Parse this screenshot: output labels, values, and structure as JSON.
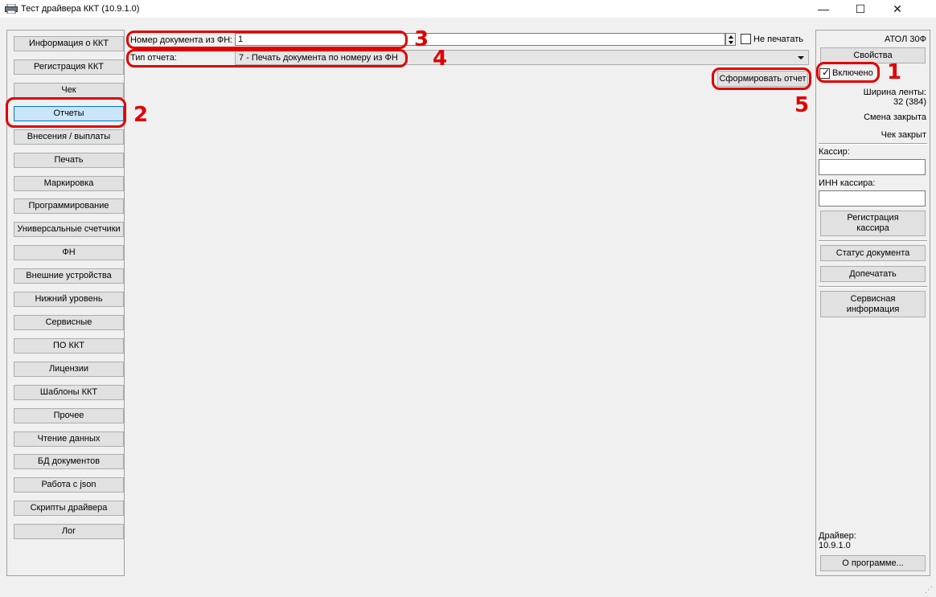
{
  "window": {
    "title": "Тест драйвера ККТ (10.9.1.0)",
    "controls": {
      "minimize": "—",
      "maximize": "☐",
      "close": "✕"
    }
  },
  "nav": {
    "items": [
      {
        "label": "Информация о ККТ",
        "active": false
      },
      {
        "label": "Регистрация ККТ",
        "active": false
      },
      {
        "label": "Чек",
        "active": false
      },
      {
        "label": "Отчеты",
        "active": true
      },
      {
        "label": "Внесения / выплаты",
        "active": false
      },
      {
        "label": "Печать",
        "active": false
      },
      {
        "label": "Маркировка",
        "active": false
      },
      {
        "label": "Программирование",
        "active": false
      },
      {
        "label": "Универсальные счетчики",
        "active": false
      },
      {
        "label": "ФН",
        "active": false
      },
      {
        "label": "Внешние устройства",
        "active": false
      },
      {
        "label": "Нижний уровень",
        "active": false
      },
      {
        "label": "Сервисные",
        "active": false
      },
      {
        "label": "ПО ККТ",
        "active": false
      },
      {
        "label": "Лицензии",
        "active": false
      },
      {
        "label": "Шаблоны ККТ",
        "active": false
      },
      {
        "label": "Прочее",
        "active": false
      },
      {
        "label": "Чтение данных",
        "active": false
      },
      {
        "label": "БД документов",
        "active": false
      },
      {
        "label": "Работа с json",
        "active": false
      },
      {
        "label": "Скрипты драйвера",
        "active": false
      },
      {
        "label": "Лог",
        "active": false
      }
    ]
  },
  "report": {
    "doc_number_label": "Номер документа из ФН:",
    "doc_number_value": "1",
    "no_print_label": "Не печатать",
    "no_print_checked": false,
    "report_type_label": "Тип отчета:",
    "report_type_value": "7 - Печать документа по номеру из ФН",
    "generate_label": "Сформировать отчет"
  },
  "right": {
    "device_name": "АТОЛ 30Ф",
    "properties_label": "Свойства",
    "enabled_label": "Включено",
    "enabled_checked": true,
    "tape_width_label": "Ширина ленты:",
    "tape_width_value": "32 (384)",
    "shift_status": "Смена закрыта",
    "receipt_status": "Чек закрыт",
    "cashier_label": "Кассир:",
    "cashier_value": "",
    "cashier_inn_label": "ИНН кассира:",
    "cashier_inn_value": "",
    "register_cashier_line1": "Регистрация",
    "register_cashier_line2": "кассира",
    "doc_status_label": "Статус документа",
    "reprint_label": "Допечатать",
    "service_info_line1": "Сервисная",
    "service_info_line2": "информация",
    "driver_label": "Драйвер:",
    "driver_version": "10.9.1.0",
    "about_label": "О программе..."
  },
  "annotations": {
    "accent_color": "#e00000",
    "markers": [
      "1",
      "2",
      "3",
      "4",
      "5"
    ]
  }
}
